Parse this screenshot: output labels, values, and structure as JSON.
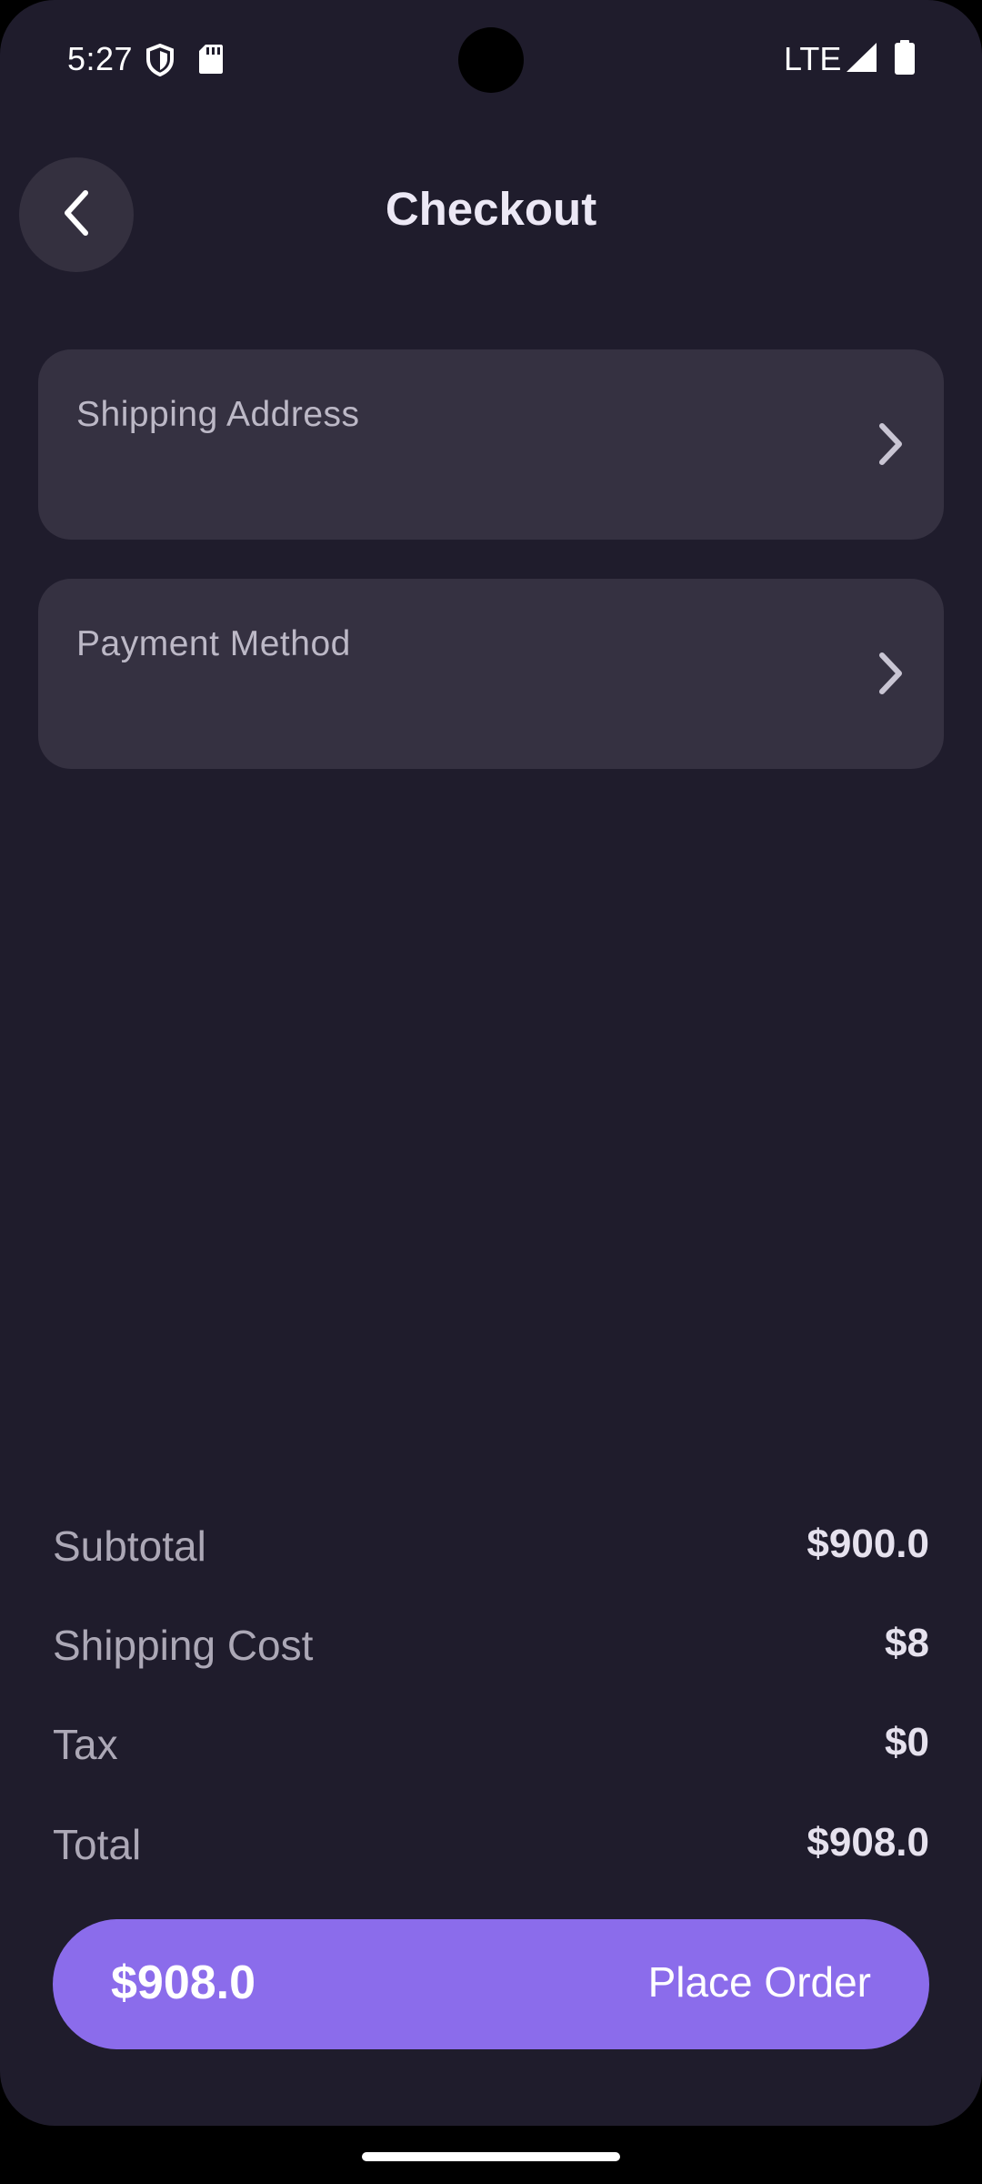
{
  "status_bar": {
    "time": "5:27",
    "network": "LTE",
    "icons": [
      "shield-icon",
      "sd-card-icon",
      "signal-icon",
      "battery-icon"
    ]
  },
  "header": {
    "title": "Checkout",
    "back_icon": "chevron-left-icon"
  },
  "sections": [
    {
      "label": "Shipping Address",
      "icon": "chevron-right-icon"
    },
    {
      "label": "Payment Method",
      "icon": "chevron-right-icon"
    }
  ],
  "summary": {
    "subtotal": {
      "label": "Subtotal",
      "value": "$900.0"
    },
    "shipping": {
      "label": "Shipping Cost",
      "value": "$8"
    },
    "tax": {
      "label": "Tax",
      "value": "$0"
    },
    "total": {
      "label": "Total",
      "value": "$908.0"
    }
  },
  "place_order": {
    "amount": "$908.0",
    "label": "Place Order"
  },
  "colors": {
    "background": "#1f1c2c",
    "card": "#353141",
    "accent": "#8b6ceb",
    "text_primary": "#e6e2ee",
    "text_secondary": "#aca8b6"
  }
}
